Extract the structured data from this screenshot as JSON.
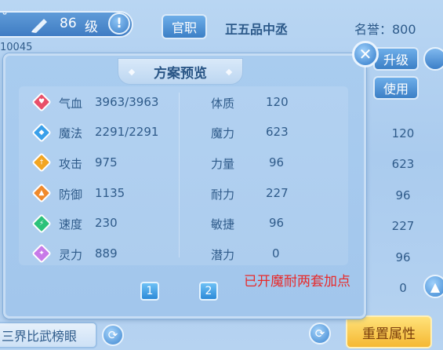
{
  "header": {
    "name_fragment": "˘",
    "level": "86",
    "level_unit": "级",
    "player_id": "10045",
    "official_button": "官职",
    "rank": "正五品中丞",
    "fame": "名誉：800"
  },
  "side_buttons": {
    "upgrade": "升级",
    "use": "使用"
  },
  "right_values": [
    "120",
    "623",
    "96",
    "227",
    "96",
    "0"
  ],
  "panel": {
    "title": "方案预览",
    "left_stats": [
      {
        "label": "气血",
        "value": "3963/3963",
        "color": "#e8506a"
      },
      {
        "label": "魔法",
        "value": "2291/2291",
        "color": "#3aa0ea"
      },
      {
        "label": "攻击",
        "value": "975",
        "color": "#f2a522"
      },
      {
        "label": "防御",
        "value": "1135",
        "color": "#f08a2c"
      },
      {
        "label": "速度",
        "value": "230",
        "color": "#2cc27a"
      },
      {
        "label": "灵力",
        "value": "889",
        "color": "#c87ae8"
      }
    ],
    "right_stats": [
      {
        "label": "体质",
        "value": "120"
      },
      {
        "label": "魔力",
        "value": "623"
      },
      {
        "label": "力量",
        "value": "96"
      },
      {
        "label": "耐力",
        "value": "227"
      },
      {
        "label": "敏捷",
        "value": "96"
      },
      {
        "label": "潜力",
        "value": "0"
      }
    ],
    "pages": [
      "1",
      "2"
    ],
    "note": "已开魔耐两套加点"
  },
  "bottom": {
    "ranking": "三界比武榜眼",
    "reset_button": "重置属性"
  }
}
